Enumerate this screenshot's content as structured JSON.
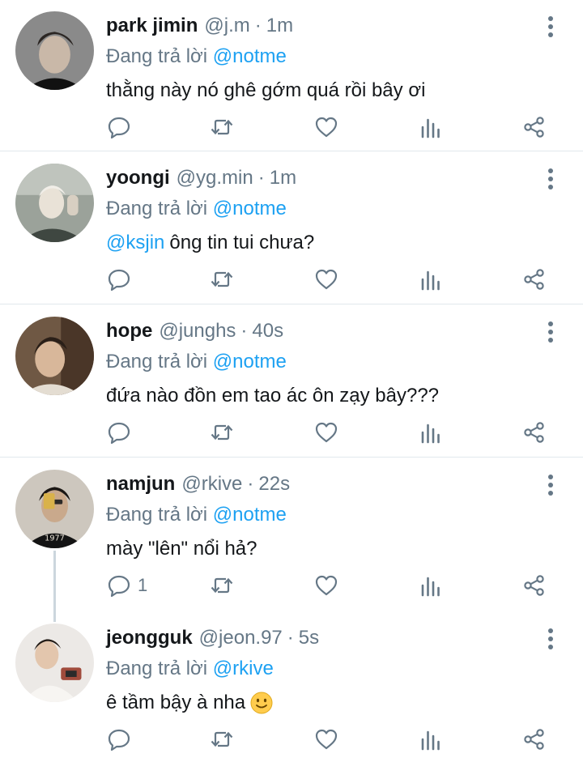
{
  "tweets": [
    {
      "name": "park jimin",
      "handle": "@j.m",
      "time": "1m",
      "reply_prefix": "Đang trả lời",
      "reply_to": "@notme",
      "mention": "",
      "text": "thằng này nó ghê gớm quá rồi bây ơi",
      "reply_count": ""
    },
    {
      "name": "yoongi",
      "handle": "@yg.min",
      "time": "1m",
      "reply_prefix": "Đang trả lời",
      "reply_to": "@notme",
      "mention": "@ksjin",
      "text": "ông tin tui chưa?",
      "reply_count": ""
    },
    {
      "name": "hope",
      "handle": "@junghs",
      "time": "40s",
      "reply_prefix": "Đang trả lời",
      "reply_to": "@notme",
      "mention": "",
      "text": "đứa nào đồn em tao ác ôn zạy bây???",
      "reply_count": ""
    },
    {
      "name": "namjun",
      "handle": "@rkive",
      "time": "22s",
      "reply_prefix": "Đang trả lời",
      "reply_to": "@notme",
      "mention": "",
      "text": "mày \"lên\" nổi hả?",
      "reply_count": "1"
    },
    {
      "name": "jeongguk",
      "handle": "@jeon.97",
      "time": "5s",
      "reply_prefix": "Đang trả lời",
      "reply_to": "@rkive",
      "mention": "",
      "text": "ê tầm bậy à nha",
      "reply_count": ""
    }
  ],
  "separator": "·",
  "icons": {
    "more": "more-vertical-icon",
    "reply": "reply-icon",
    "retweet": "retweet-icon",
    "like": "heart-icon",
    "analytics": "analytics-icon",
    "share": "share-icon",
    "emoji": "slightly-smiling-face-emoji"
  },
  "colors": {
    "accent": "#1da1f2",
    "secondary_text": "#657786",
    "divider": "#e1e8ed",
    "thread_line": "#ccd6dd"
  }
}
